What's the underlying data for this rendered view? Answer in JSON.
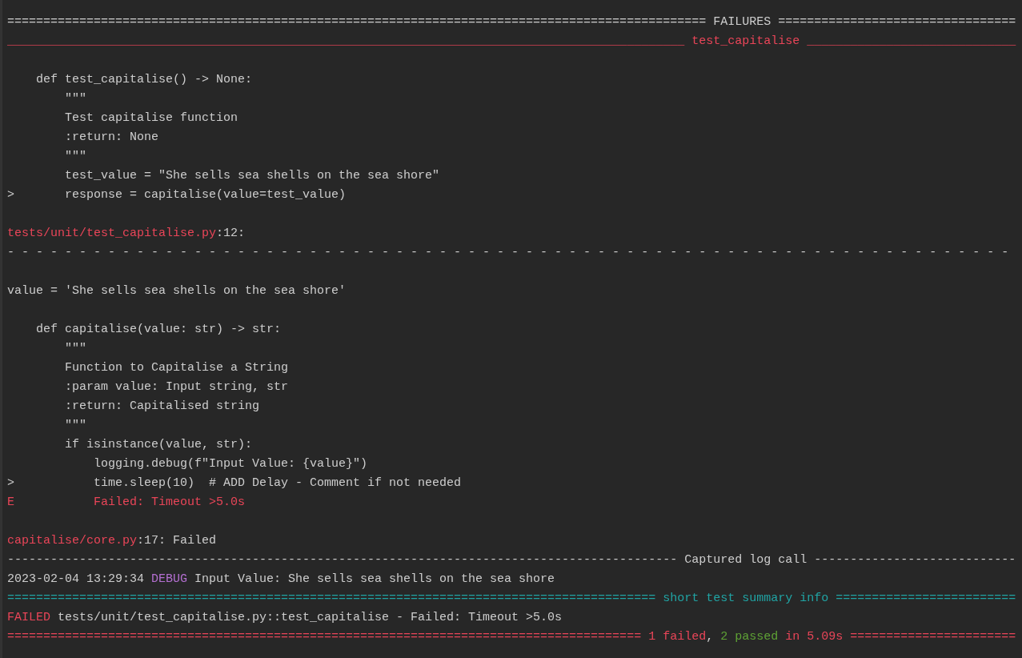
{
  "terminal": {
    "blocks": [
      {
        "lines": [
          {
            "segments": [
              {
                "kind": "plain",
                "text": "================================================================================================= FAILURES ================================="
              }
            ]
          },
          {
            "segments": [
              {
                "kind": "failure",
                "text": "______________________________________________________________________________________________ test_capitalise _____________________________"
              }
            ]
          }
        ]
      },
      {
        "lines": [
          {
            "segments": [
              {
                "kind": "plain",
                "text": "    def test_capitalise() -> None:"
              }
            ]
          },
          {
            "segments": [
              {
                "kind": "plain",
                "text": "        \"\"\""
              }
            ]
          },
          {
            "segments": [
              {
                "kind": "plain",
                "text": "        Test capitalise function"
              }
            ]
          },
          {
            "segments": [
              {
                "kind": "plain",
                "text": "        :return: None"
              }
            ]
          },
          {
            "segments": [
              {
                "kind": "plain",
                "text": "        \"\"\""
              }
            ]
          },
          {
            "segments": [
              {
                "kind": "plain",
                "text": "        test_value = \"She sells sea shells on the sea shore\""
              }
            ]
          },
          {
            "segments": [
              {
                "kind": "plain",
                "text": ">       response = capitalise(value=test_value)"
              }
            ]
          }
        ]
      },
      {
        "lines": [
          {
            "segments": [
              {
                "kind": "failure",
                "text": "tests/unit/test_capitalise.py"
              },
              {
                "kind": "plain",
                "text": ":12:"
              }
            ]
          },
          {
            "segments": [
              {
                "kind": "plain",
                "text": "- - - - - - - - - - - - - - - - - - - - - - - - - - - - - - - - - - - - - - - - - - - - - - - - - - - - - - - - - - - - - - - - - - - - - -"
              }
            ]
          }
        ]
      },
      {
        "lines": [
          {
            "segments": [
              {
                "kind": "plain",
                "text": "value = 'She sells sea shells on the sea shore'"
              }
            ]
          }
        ]
      },
      {
        "lines": [
          {
            "segments": [
              {
                "kind": "plain",
                "text": "    def capitalise(value: str) -> str:"
              }
            ]
          },
          {
            "segments": [
              {
                "kind": "plain",
                "text": "        \"\"\""
              }
            ]
          },
          {
            "segments": [
              {
                "kind": "plain",
                "text": "        Function to Capitalise a String"
              }
            ]
          },
          {
            "segments": [
              {
                "kind": "plain",
                "text": "        :param value: Input string, str"
              }
            ]
          },
          {
            "segments": [
              {
                "kind": "plain",
                "text": "        :return: Capitalised string"
              }
            ]
          },
          {
            "segments": [
              {
                "kind": "plain",
                "text": "        \"\"\""
              }
            ]
          },
          {
            "segments": [
              {
                "kind": "plain",
                "text": "        if isinstance(value, str):"
              }
            ]
          },
          {
            "segments": [
              {
                "kind": "plain",
                "text": "            logging.debug(f\"Input Value: {value}\")"
              }
            ]
          },
          {
            "segments": [
              {
                "kind": "plain",
                "text": ">           time.sleep(10)  # ADD Delay - Comment if not needed"
              }
            ]
          },
          {
            "segments": [
              {
                "kind": "failure",
                "text": "E           Failed: Timeout >5.0s"
              }
            ]
          }
        ]
      },
      {
        "lines": [
          {
            "segments": [
              {
                "kind": "failure",
                "text": "capitalise/core.py"
              },
              {
                "kind": "plain",
                "text": ":17: Failed"
              }
            ]
          },
          {
            "segments": [
              {
                "kind": "plain",
                "text": "--------------------------------------------------------------------------------------------- Captured log call ----------------------------"
              }
            ]
          },
          {
            "segments": [
              {
                "kind": "plain",
                "text": "2023-02-04 13:29:34 "
              },
              {
                "kind": "debug",
                "text": "DEBUG"
              },
              {
                "kind": "plain",
                "text": " Input Value: She sells sea shells on the sea shore"
              }
            ]
          },
          {
            "segments": [
              {
                "kind": "info",
                "text": "========================================================================================== short test summary info ========================="
              }
            ]
          },
          {
            "segments": [
              {
                "kind": "failure",
                "text": "FAILED"
              },
              {
                "kind": "plain",
                "text": " tests/unit/test_capitalise.py::test_capitalise - Failed: Timeout >5.0s"
              }
            ]
          },
          {
            "segments": [
              {
                "kind": "failure",
                "text": "======================================================================================== 1 failed"
              },
              {
                "kind": "plain",
                "text": ", "
              },
              {
                "kind": "passed",
                "text": "2 passed"
              },
              {
                "kind": "failure",
                "text": " in 5.09s ======================="
              }
            ]
          }
        ]
      }
    ]
  }
}
